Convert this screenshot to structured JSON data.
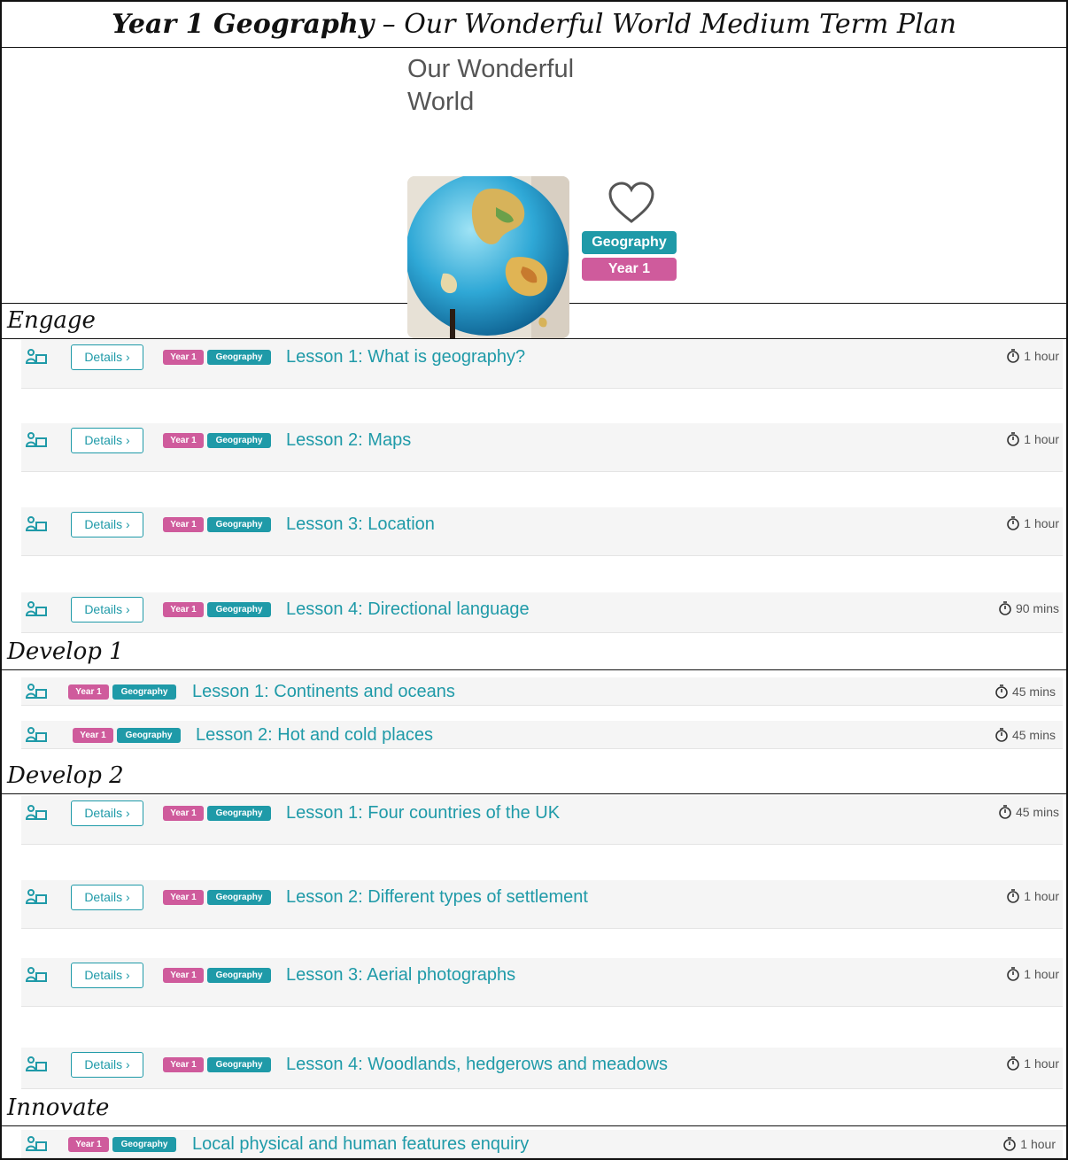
{
  "header": {
    "title_bold": "Year 1 Geography",
    "title_rest": " – Our Wonderful World Medium Term Plan"
  },
  "hero": {
    "title": "Our Wonderful World",
    "tags": {
      "subject": "Geography",
      "year": "Year 1"
    }
  },
  "common": {
    "details_label": "Details ›",
    "year_pill": "Year 1",
    "subject_pill": "Geography"
  },
  "sections": [
    {
      "name": "Engage",
      "lessons": [
        {
          "title": "Lesson 1: What is geography?",
          "duration": "1 hour"
        },
        {
          "title": "Lesson 2: Maps",
          "duration": "1 hour"
        },
        {
          "title": "Lesson 3: Location",
          "duration": "1 hour"
        },
        {
          "title": "Lesson 4: Directional language",
          "duration": "90 mins"
        }
      ]
    },
    {
      "name": "Develop 1",
      "lessons": [
        {
          "title": "Lesson 1: Continents and oceans",
          "duration": "45 mins"
        },
        {
          "title": "Lesson 2: Hot and cold places",
          "duration": "45 mins"
        }
      ]
    },
    {
      "name": "Develop 2",
      "lessons": [
        {
          "title": "Lesson 1: Four countries of the UK",
          "duration": "45 mins"
        },
        {
          "title": "Lesson 2: Different types of settlement",
          "duration": "1 hour"
        },
        {
          "title": "Lesson 3: Aerial photographs",
          "duration": "1 hour"
        },
        {
          "title": "Lesson 4: Woodlands, hedgerows and meadows",
          "duration": "1 hour"
        }
      ]
    },
    {
      "name": "Innovate",
      "lessons": [
        {
          "title": "Local physical and human features enquiry",
          "duration": "1 hour"
        }
      ]
    }
  ],
  "colors": {
    "teal": "#1f9aa8",
    "pink": "#cf5b9c"
  },
  "icons": {
    "lesson": "tutor-board-icon",
    "duration": "stopwatch-icon",
    "favourite": "heart-icon"
  }
}
